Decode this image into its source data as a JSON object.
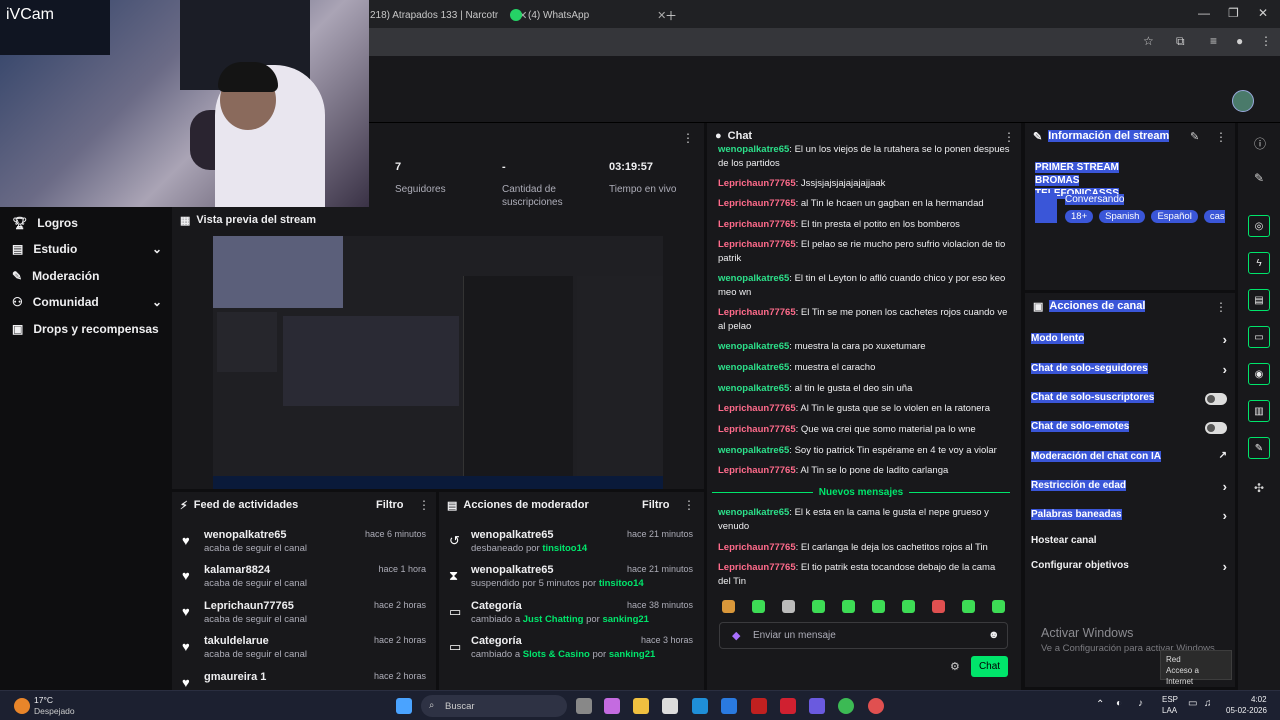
{
  "browser": {
    "tabs": [
      {
        "label": "218) Atrapados 133 | Narcotr"
      },
      {
        "label": "(4) WhatsApp"
      }
    ]
  },
  "camera": {
    "label": "iVCam"
  },
  "nav": {
    "items": [
      {
        "label": "Logros"
      },
      {
        "label": "Estudio"
      },
      {
        "label": "Moderación"
      },
      {
        "label": "Comunidad"
      },
      {
        "label": "Drops y recompensas"
      }
    ]
  },
  "stats": [
    {
      "value": "7",
      "label": "Seguidores"
    },
    {
      "value": "-",
      "label": "Cantidad de suscripciones"
    },
    {
      "value": "03:19:57",
      "label": "Tiempo en vivo"
    }
  ],
  "preview": {
    "title": "Vista previa del stream"
  },
  "feed": {
    "title": "Feed de actividades",
    "filter": "Filtro",
    "items": [
      {
        "name": "wenopalkatre65",
        "sub": "acaba de seguir el canal",
        "time": "hace 6 minutos"
      },
      {
        "name": "kalamar8824",
        "sub": "acaba de seguir el canal",
        "time": "hace 1 hora"
      },
      {
        "name": "Leprichaun77765",
        "sub": "acaba de seguir el canal",
        "time": "hace 2 horas"
      },
      {
        "name": "takuldelarue",
        "sub": "acaba de seguir el canal",
        "time": "hace 2 horas"
      },
      {
        "name": "gmaureira 1",
        "sub": "",
        "time": "hace 2 horas"
      }
    ]
  },
  "modactions": {
    "title": "Acciones de moderador",
    "filter": "Filtro",
    "items": [
      {
        "name": "wenopalkatre65",
        "pre": "desbaneado por ",
        "hl": "tinsitoo14",
        "post": "",
        "time": "hace 21 minutos"
      },
      {
        "name": "wenopalkatre65",
        "pre": "suspendido por 5 minutos por ",
        "hl": "tinsitoo14",
        "post": "",
        "time": "hace 21 minutos"
      },
      {
        "name": "Categoría",
        "pre": "cambiado a ",
        "hl": "Just Chatting",
        "post": " por ",
        "hl2": "sanking21",
        "time": "hace 38 minutos"
      },
      {
        "name": "Categoría",
        "pre": "cambiado a ",
        "hl": "Slots & Casino",
        "post": " por ",
        "hl2": "sanking21",
        "time": "hace 3 horas"
      }
    ]
  },
  "chat": {
    "title": "Chat",
    "messages": [
      {
        "user": "wenopalkatre65",
        "color": "u2",
        "text": ": El un los viejos de la rutahera se lo ponen despues de los partidos"
      },
      {
        "user": "Leprichaun77765",
        "color": "u1",
        "text": ": Jssjsjajsjajajajajjaak"
      },
      {
        "user": "Leprichaun77765",
        "color": "u1",
        "text": ": al Tin le hcaen un gagban en la hermandad"
      },
      {
        "user": "Leprichaun77765",
        "color": "u1",
        "text": ": El tin presta el potito en los bomberos"
      },
      {
        "user": "Leprichaun77765",
        "color": "u1",
        "text": ": El pelao se rie mucho pero sufrio violacion de tio patrik"
      },
      {
        "user": "wenopalkatre65",
        "color": "u2",
        "text": ": El tin el Leyton lo aflló cuando chico y por eso keo meo wn"
      },
      {
        "user": "Leprichaun77765",
        "color": "u1",
        "text": ": El Tin se me ponen los cachetes rojos cuando ve al pelao"
      },
      {
        "user": "wenopalkatre65",
        "color": "u2",
        "text": ": muestra la cara po xuxetumare"
      },
      {
        "user": "wenopalkatre65",
        "color": "u2",
        "text": ": muestra el caracho"
      },
      {
        "user": "wenopalkatre65",
        "color": "u2",
        "text": ": al tin le gusta el deo sin uña"
      },
      {
        "user": "Leprichaun77765",
        "color": "u1",
        "text": ": Al Tin le gusta que se lo violen en la ratonera"
      },
      {
        "user": "Leprichaun77765",
        "color": "u1",
        "text": ": Que wa crei que somo material pa lo wne"
      },
      {
        "user": "wenopalkatre65",
        "color": "u2",
        "text": ": Soy tio patrick Tin espérame en 4 te voy a violar"
      },
      {
        "user": "Leprichaun77765",
        "color": "u1",
        "text": ": Al Tin se lo pone de ladito carlanga"
      },
      {
        "user": "wenopalkatre65",
        "color": "u2",
        "text": ": El k esta en la cama le gusta el nepe grueso y venudo"
      },
      {
        "user": "Leprichaun77765",
        "color": "u1",
        "text": ": El carlanga le deja los cachetitos rojos al Tin"
      },
      {
        "user": "Leprichaun77765",
        "color": "u1",
        "text": ": El tio patrik esta tocandose debajo de la cama del Tin"
      }
    ],
    "new_messages": "Nuevos mensajes",
    "input_placeholder": "Enviar un mensaje",
    "send": "Chat"
  },
  "streaminfo": {
    "title": "Información del stream",
    "stream_title": "PRIMER STREAM BROMAS TELEFONICASSS",
    "category": "Conversando",
    "tags": [
      "18+",
      "Spanish",
      "Español",
      "casir"
    ]
  },
  "channel": {
    "title": "Acciones de canal",
    "actions": [
      {
        "label": "Modo lento",
        "kind": "chev",
        "hl": true
      },
      {
        "label": "Chat de solo-seguidores",
        "kind": "chev",
        "hl": true
      },
      {
        "label": "Chat de solo-suscriptores",
        "kind": "toggle",
        "hl": true
      },
      {
        "label": "Chat de solo-emotes",
        "kind": "toggle",
        "hl": true
      },
      {
        "label": "Moderación del chat con IA",
        "kind": "ext",
        "hl": true
      },
      {
        "label": "Restricción de edad",
        "kind": "chev",
        "hl": true
      },
      {
        "label": "Palabras baneadas",
        "kind": "chev",
        "hl": true
      },
      {
        "label": "Hostear canal",
        "kind": "none",
        "hl": false
      },
      {
        "label": "Configurar objetivos",
        "kind": "chev",
        "hl": false
      }
    ]
  },
  "watermark": {
    "line1": "Activar Windows",
    "line2": "Ve a Configuración para activar Windows."
  },
  "tooltip": {
    "line1": "Red",
    "line2": "Acceso a Internet"
  },
  "taskbar": {
    "weather_temp": "17°C",
    "weather_desc": "Despejado",
    "search": "Buscar",
    "lang1": "ESP",
    "lang2": "LAA",
    "time": "4:02",
    "date": "05-02-2026"
  }
}
